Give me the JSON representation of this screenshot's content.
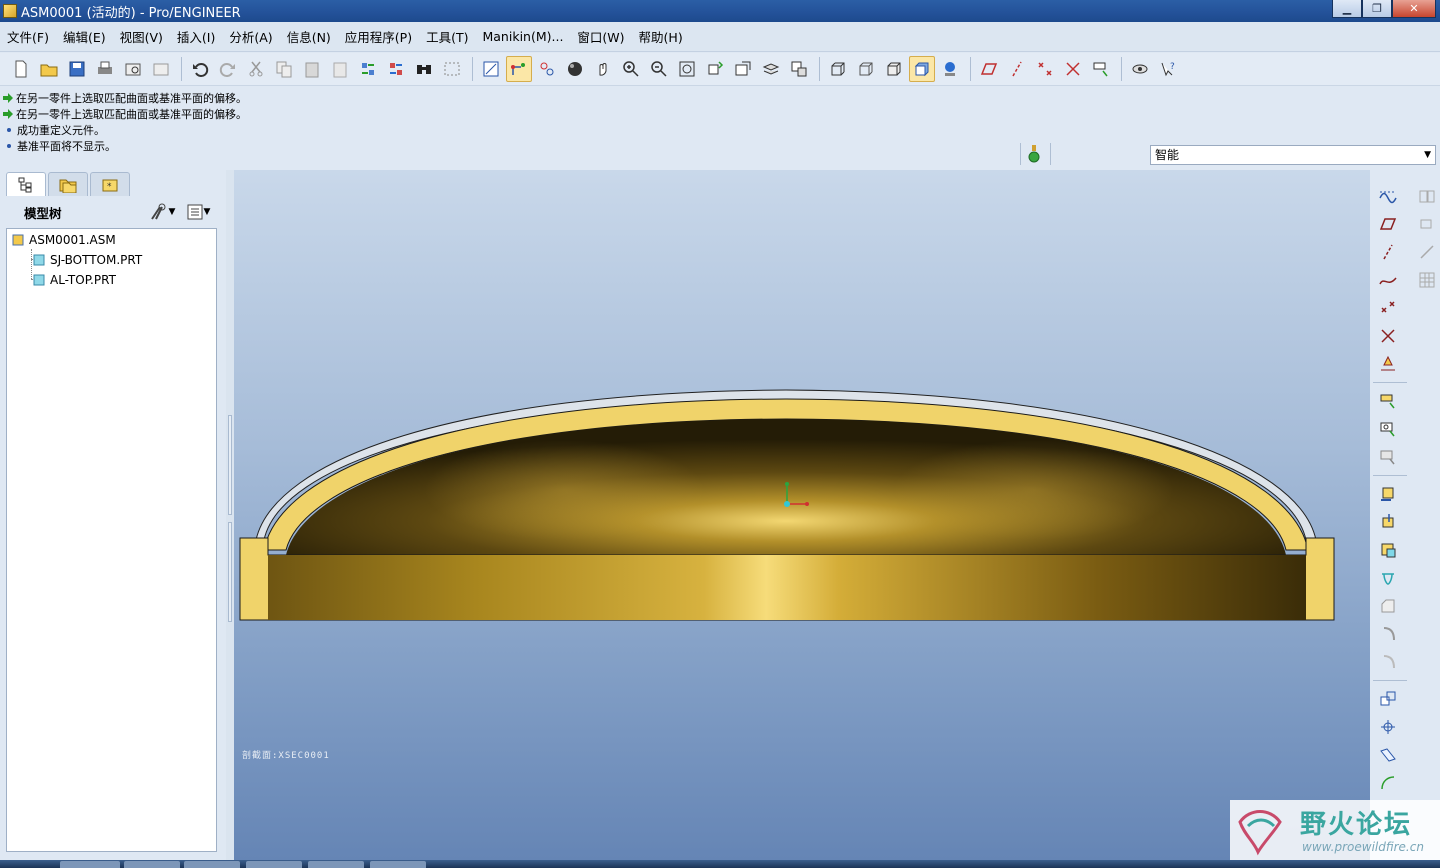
{
  "window": {
    "title": "ASM0001 (活动的) - Pro/ENGINEER",
    "minimize": "▁",
    "maximize": "❐",
    "close": "✕"
  },
  "menu": [
    "文件(F)",
    "编辑(E)",
    "视图(V)",
    "插入(I)",
    "分析(A)",
    "信息(N)",
    "应用程序(P)",
    "工具(T)",
    "Manikin(M)...",
    "窗口(W)",
    "帮助(H)"
  ],
  "messages": [
    {
      "text": "在另一零件上选取匹配曲面或基准平面的偏移。",
      "type": "prompt"
    },
    {
      "text": "在另一零件上选取匹配曲面或基准平面的偏移。",
      "type": "prompt"
    },
    {
      "text": "成功重定义元件。",
      "type": "info"
    },
    {
      "text": "基准平面将不显示。",
      "type": "info"
    }
  ],
  "selection_filter": {
    "value": "智能"
  },
  "navigator": {
    "title": "模型树",
    "tree": [
      {
        "label": "ASM0001.ASM",
        "kind": "assembly"
      },
      {
        "label": "SJ-BOTTOM.PRT",
        "kind": "part"
      },
      {
        "label": "AL-TOP.PRT",
        "kind": "part"
      }
    ]
  },
  "graphics": {
    "xsec_label": "剖截面:XSEC0001"
  },
  "watermark": {
    "text": "野火论坛",
    "url": "www.proewildfire.cn"
  },
  "colors": {
    "part_yellow": "#f0d36a",
    "cavity_dark": "#2a2208",
    "highlight": "#f6dc7a",
    "bg_top": "#c9d8ea",
    "bg_bottom": "#6585b5"
  }
}
